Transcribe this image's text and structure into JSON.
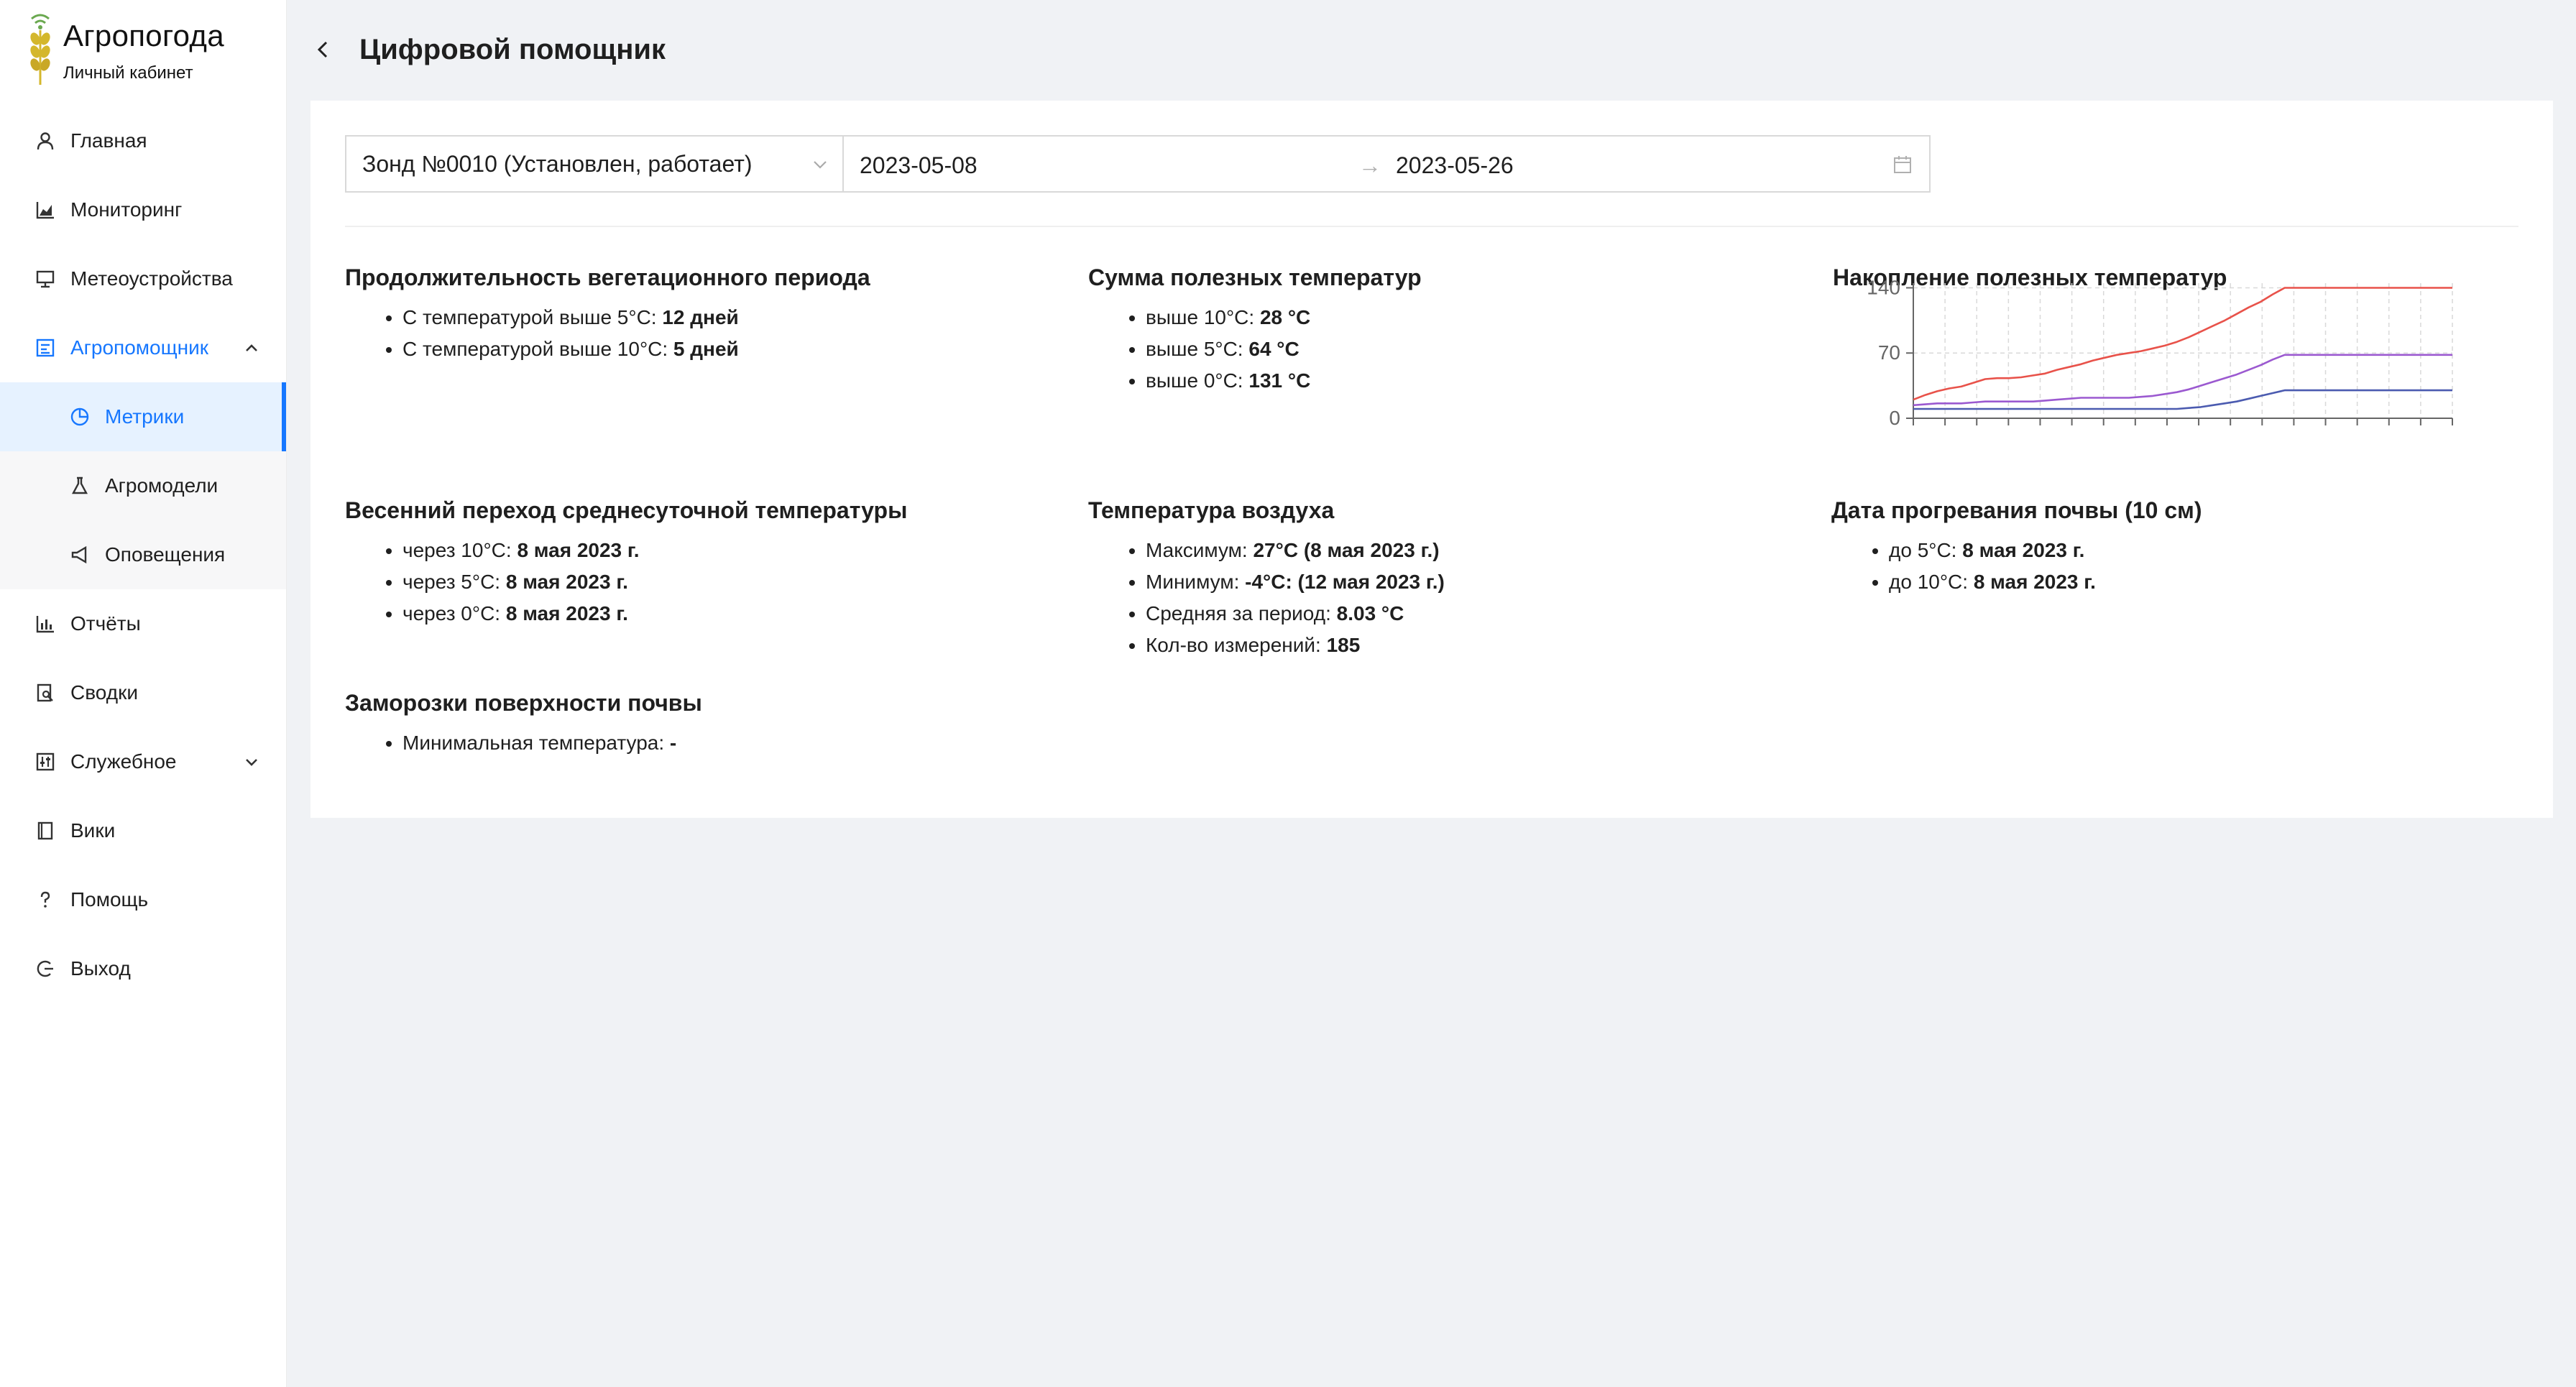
{
  "app": {
    "title": "Агропогода",
    "subtitle": "Личный кабинет"
  },
  "menu": {
    "items": [
      {
        "label": "Главная",
        "icon": "user-icon"
      },
      {
        "label": "Мониторинг",
        "icon": "area-chart-icon"
      },
      {
        "label": "Метеоустройства",
        "icon": "desktop-icon"
      },
      {
        "label": "Агропомощник",
        "icon": "assistant-icon",
        "expanded": true
      },
      {
        "label": "Отчёты",
        "icon": "bar-chart-icon"
      },
      {
        "label": "Сводки",
        "icon": "file-search-icon"
      },
      {
        "label": "Служебное",
        "icon": "control-icon",
        "expanded": false
      },
      {
        "label": "Вики",
        "icon": "book-icon"
      },
      {
        "label": "Помощь",
        "icon": "question-icon"
      },
      {
        "label": "Выход",
        "icon": "logout-icon"
      }
    ],
    "submenu": [
      {
        "label": "Метрики",
        "icon": "pie-chart-icon",
        "active": true
      },
      {
        "label": "Агромодели",
        "icon": "experiment-icon"
      },
      {
        "label": "Оповещения",
        "icon": "notification-icon"
      }
    ]
  },
  "header": {
    "title": "Цифровой помощник"
  },
  "filters": {
    "probe": "Зонд №0010 (Установлен, работает)",
    "date_from": "2023-05-08",
    "date_to": "2023-05-26"
  },
  "sections": {
    "vegetation": {
      "title": "Продолжительность вегетационного периода",
      "rows": [
        {
          "label": "С температурой выше 5°С: ",
          "value": "12 дней"
        },
        {
          "label": "С температурой выше 10°С: ",
          "value": "5 дней"
        }
      ]
    },
    "sum_temps": {
      "title": "Сумма полезных температур",
      "rows": [
        {
          "label": "выше 10°С: ",
          "value": "28 °С"
        },
        {
          "label": "выше 5°С: ",
          "value": "64 °С"
        },
        {
          "label": "выше 0°С: ",
          "value": "131 °С"
        }
      ]
    },
    "accumulation": {
      "title": "Накопление полезных температур"
    },
    "spring": {
      "title": "Весенний переход среднесуточной температуры",
      "rows": [
        {
          "label": "через 10°С: ",
          "value": "8 мая 2023 г."
        },
        {
          "label": "через 5°С: ",
          "value": "8 мая 2023 г."
        },
        {
          "label": "через 0°С: ",
          "value": "8 мая 2023 г."
        }
      ]
    },
    "air": {
      "title": "Температура воздуха",
      "rows": [
        {
          "label": "Максимум: ",
          "value": "27°С (8 мая 2023 г.)"
        },
        {
          "label": "Минимум: ",
          "value": "-4°С: (12 мая 2023 г.)"
        },
        {
          "label": "Средняя за период: ",
          "value": "8.03 °С"
        },
        {
          "label": "Кол-во измерений: ",
          "value": "185"
        }
      ]
    },
    "soil": {
      "title": "Дата прогревания почвы (10 см)",
      "rows": [
        {
          "label": "до 5°С: ",
          "value": "8 мая 2023 г."
        },
        {
          "label": "до 10°С: ",
          "value": "8 мая 2023 г."
        }
      ]
    },
    "frost": {
      "title": "Заморозки поверхности почвы",
      "rows": [
        {
          "label": "Минимальная температура: ",
          "value": "-"
        }
      ]
    }
  },
  "chart_data": {
    "type": "line",
    "title": "",
    "xlabel": "",
    "ylabel": "",
    "ylim": [
      0,
      145
    ],
    "yticks": [
      0,
      70,
      140
    ],
    "grid": true,
    "x": [
      0,
      1,
      2,
      3,
      4,
      5,
      6,
      7,
      8,
      9,
      10,
      11,
      12,
      13,
      14,
      15,
      16,
      17,
      18,
      19,
      20,
      21,
      22,
      23,
      24,
      25,
      26,
      27,
      28,
      29,
      30,
      31,
      32,
      33,
      34,
      35,
      36,
      37,
      38,
      39,
      40,
      41,
      42,
      43,
      44,
      45
    ],
    "series": [
      {
        "color": "#e8524a",
        "values": [
          20,
          25,
          29,
          32,
          34,
          38,
          42,
          43,
          43,
          44,
          46,
          48,
          52,
          55,
          58,
          62,
          65,
          68,
          70,
          72,
          75,
          78,
          82,
          87,
          93,
          99,
          105,
          112,
          119,
          125,
          133,
          140,
          140,
          140,
          140,
          140,
          140,
          140,
          140,
          140,
          140,
          140,
          140,
          140,
          140,
          140
        ]
      },
      {
        "color": "#9b59d0",
        "values": [
          14,
          15,
          16,
          16,
          16,
          17,
          18,
          18,
          18,
          18,
          18,
          19,
          20,
          21,
          22,
          22,
          22,
          22,
          22,
          23,
          24,
          26,
          28,
          31,
          35,
          39,
          43,
          47,
          52,
          57,
          63,
          68,
          68,
          68,
          68,
          68,
          68,
          68,
          68,
          68,
          68,
          68,
          68,
          68,
          68,
          68
        ]
      },
      {
        "color": "#4b5bb0",
        "values": [
          10,
          10,
          10,
          10,
          10,
          10,
          10,
          10,
          10,
          10,
          10,
          10,
          10,
          10,
          10,
          10,
          10,
          10,
          10,
          10,
          10,
          10,
          10,
          11,
          12,
          14,
          16,
          18,
          21,
          24,
          27,
          30,
          30,
          30,
          30,
          30,
          30,
          30,
          30,
          30,
          30,
          30,
          30,
          30,
          30,
          30
        ]
      }
    ]
  }
}
